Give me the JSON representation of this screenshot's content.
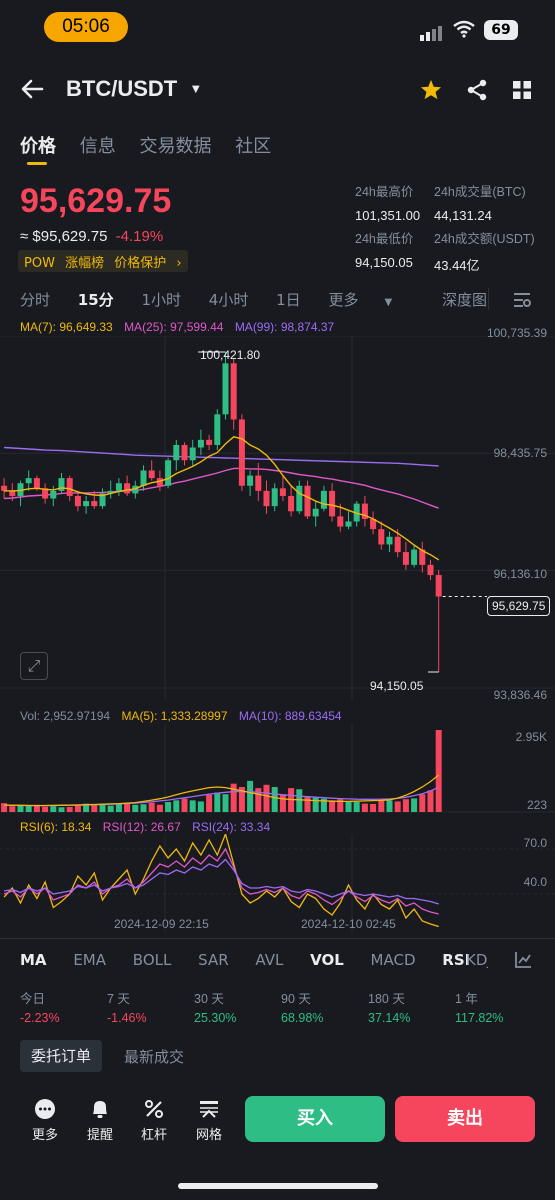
{
  "status": {
    "time": "05:06",
    "battery": "69"
  },
  "header": {
    "pair": "BTC/USDT"
  },
  "tabs": [
    "价格",
    "信息",
    "交易数据",
    "社区"
  ],
  "ticker": {
    "price": "95,629.75",
    "approx": "≈ $95,629.75",
    "change": "-4.19%",
    "tags": [
      "POW",
      "涨幅榜",
      "价格保护"
    ],
    "stats": [
      {
        "label": "24h最高价",
        "value": "101,351.00"
      },
      {
        "label": "24h成交量(BTC)",
        "value": "44,131.24"
      },
      {
        "label": "24h最低价",
        "value": "94,150.05"
      },
      {
        "label": "24h成交额(USDT)",
        "value": "43.44亿"
      }
    ]
  },
  "intervals": [
    "分时",
    "15分",
    "1小时",
    "4小时",
    "1日",
    "更多",
    "深度图"
  ],
  "indicators": {
    "ma7": "MA(7): 96,649.33",
    "ma25": "MA(25): 97,599.44",
    "ma99": "MA(99): 98,874.37",
    "vol": "Vol: 2,952.97194",
    "vol_ma5": "MA(5): 1,333.28997",
    "vol_ma10": "MA(10): 889.63454",
    "rsi6": "RSI(6): 18.34",
    "rsi12": "RSI(12): 26.67",
    "rsi24": "RSI(24): 33.34"
  },
  "chart_data": [
    {
      "type": "candlestick",
      "y_ticks": [
        "100,735.39",
        "98,435.75",
        "96,136.10",
        "93,836.46"
      ],
      "ylim": [
        93836.46,
        100735.39
      ],
      "annotations": {
        "high": "100,421.80",
        "low": "94,150.05",
        "last": "95,629.75"
      },
      "x_ticks": [
        "2024-12-09 22:15",
        "2024-12-10 02:45"
      ],
      "candles": [
        [
          97800,
          97950,
          97550,
          97700
        ],
        [
          97700,
          97850,
          97500,
          97600
        ],
        [
          97600,
          97900,
          97400,
          97850
        ],
        [
          97850,
          98100,
          97700,
          97950
        ],
        [
          97950,
          98000,
          97700,
          97750
        ],
        [
          97750,
          97850,
          97450,
          97550
        ],
        [
          97550,
          97800,
          97400,
          97700
        ],
        [
          97700,
          98050,
          97650,
          97950
        ],
        [
          97950,
          98000,
          97500,
          97600
        ],
        [
          97600,
          97700,
          97300,
          97400
        ],
        [
          97400,
          97600,
          97250,
          97500
        ],
        [
          97500,
          97700,
          97350,
          97400
        ],
        [
          97400,
          97750,
          97350,
          97650
        ],
        [
          97650,
          97900,
          97550,
          97700
        ],
        [
          97700,
          97950,
          97600,
          97850
        ],
        [
          97850,
          98000,
          97600,
          97650
        ],
        [
          97650,
          97900,
          97550,
          97800
        ],
        [
          97800,
          98200,
          97700,
          98100
        ],
        [
          98100,
          98300,
          97900,
          97950
        ],
        [
          97950,
          98100,
          97700,
          97800
        ],
        [
          97800,
          98350,
          97750,
          98300
        ],
        [
          98300,
          98700,
          98100,
          98600
        ],
        [
          98600,
          98650,
          98200,
          98300
        ],
        [
          98300,
          98700,
          98200,
          98550
        ],
        [
          98550,
          98900,
          98400,
          98700
        ],
        [
          98700,
          98800,
          98500,
          98600
        ],
        [
          98600,
          99300,
          98500,
          99200
        ],
        [
          99200,
          100421.8,
          99100,
          100200
        ],
        [
          100200,
          100300,
          98900,
          99100
        ],
        [
          99100,
          99200,
          97700,
          97800
        ],
        [
          97800,
          98100,
          97600,
          98000
        ],
        [
          98000,
          98250,
          97500,
          97700
        ],
        [
          97700,
          97900,
          97250,
          97400
        ],
        [
          97400,
          97850,
          97300,
          97750
        ],
        [
          97750,
          98000,
          97500,
          97600
        ],
        [
          97600,
          97800,
          97200,
          97300
        ],
        [
          97300,
          97900,
          97250,
          97800
        ],
        [
          97800,
          97900,
          97150,
          97200
        ],
        [
          97200,
          97500,
          97000,
          97350
        ],
        [
          97350,
          97800,
          97300,
          97700
        ],
        [
          97700,
          97850,
          97100,
          97200
        ],
        [
          97200,
          97450,
          96900,
          97000
        ],
        [
          97000,
          97300,
          96950,
          97100
        ],
        [
          97100,
          97500,
          97000,
          97450
        ],
        [
          97450,
          97600,
          97000,
          97150
        ],
        [
          97150,
          97300,
          96850,
          96950
        ],
        [
          96950,
          97100,
          96550,
          96650
        ],
        [
          96650,
          96900,
          96500,
          96800
        ],
        [
          96800,
          96950,
          96400,
          96500
        ],
        [
          96500,
          96700,
          96150,
          96250
        ],
        [
          96250,
          96650,
          96200,
          96550
        ],
        [
          96550,
          96700,
          96100,
          96250
        ],
        [
          96250,
          96350,
          95950,
          96050
        ],
        [
          96050,
          96150,
          94150.05,
          95629.75
        ]
      ],
      "ma7": [
        97700,
        97700,
        97710,
        97740,
        97750,
        97730,
        97720,
        97760,
        97740,
        97680,
        97640,
        97620,
        97610,
        97650,
        97690,
        97720,
        97740,
        97810,
        97860,
        97890,
        97940,
        98040,
        98110,
        98180,
        98270,
        98380,
        98450,
        98620,
        98760,
        98720,
        98600,
        98520,
        98400,
        98220,
        98000,
        97800,
        97650,
        97580,
        97500,
        97440,
        97420,
        97380,
        97320,
        97260,
        97220,
        97150,
        97060,
        96970,
        96870,
        96760,
        96640,
        96530,
        96450,
        96350
      ],
      "ma25": [
        97550,
        97560,
        97580,
        97600,
        97610,
        97620,
        97630,
        97650,
        97660,
        97660,
        97660,
        97665,
        97670,
        97680,
        97690,
        97700,
        97710,
        97730,
        97760,
        97790,
        97820,
        97860,
        97890,
        97930,
        97970,
        98010,
        98050,
        98100,
        98140,
        98140,
        98130,
        98130,
        98120,
        98100,
        98080,
        98050,
        98020,
        98000,
        97980,
        97950,
        97930,
        97900,
        97870,
        97840,
        97810,
        97760,
        97720,
        97680,
        97640,
        97590,
        97540,
        97480,
        97420,
        97360
      ],
      "ma99": [
        98550,
        98540,
        98530,
        98520,
        98510,
        98500,
        98495,
        98490,
        98480,
        98470,
        98460,
        98450,
        98440,
        98430,
        98420,
        98410,
        98400,
        98395,
        98390,
        98385,
        98380,
        98375,
        98370,
        98365,
        98360,
        98355,
        98350,
        98345,
        98340,
        98335,
        98330,
        98325,
        98320,
        98315,
        98310,
        98305,
        98300,
        98295,
        98290,
        98285,
        98280,
        98275,
        98270,
        98265,
        98260,
        98255,
        98250,
        98245,
        98240,
        98230,
        98220,
        98210,
        98200,
        98190
      ]
    },
    {
      "type": "bar",
      "title": "Volume",
      "y_ticks": [
        "2.95K",
        "223"
      ],
      "values": [
        320,
        210,
        230,
        220,
        260,
        190,
        210,
        170,
        180,
        240,
        300,
        260,
        270,
        230,
        280,
        310,
        260,
        280,
        330,
        260,
        360,
        420,
        480,
        420,
        380,
        620,
        700,
        640,
        1020,
        900,
        1120,
        860,
        980,
        900,
        640,
        860,
        820,
        560,
        520,
        480,
        420,
        460,
        380,
        360,
        300,
        290,
        410,
        420,
        380,
        460,
        490,
        640,
        780,
        2952.97
      ],
      "ma5": [
        250,
        245,
        240,
        235,
        230,
        235,
        238,
        245,
        250,
        255,
        262,
        270,
        280,
        290,
        300,
        320,
        340,
        380,
        430,
        480,
        540,
        620,
        700,
        760,
        820,
        880,
        900,
        880,
        820,
        760,
        700,
        640,
        580,
        520,
        470,
        450,
        440,
        430,
        410,
        400,
        390,
        380,
        380,
        390,
        400,
        410,
        420,
        440,
        500,
        600,
        740,
        900,
        1100,
        1333.29
      ],
      "ma10": [
        240,
        238,
        236,
        234,
        232,
        232,
        234,
        238,
        242,
        246,
        252,
        260,
        270,
        280,
        292,
        306,
        322,
        342,
        368,
        398,
        430,
        470,
        512,
        556,
        598,
        640,
        680,
        710,
        730,
        740,
        730,
        710,
        680,
        650,
        620,
        596,
        574,
        552,
        532,
        514,
        496,
        482,
        470,
        462,
        458,
        456,
        460,
        470,
        490,
        530,
        590,
        660,
        760,
        889.63
      ]
    },
    {
      "type": "line",
      "title": "RSI",
      "y_ticks": [
        "70.0",
        "40.0"
      ],
      "ylim": [
        20,
        80
      ],
      "series": [
        {
          "name": "RSI(6)",
          "values": [
            38,
            44,
            34,
            46,
            37,
            48,
            31,
            35,
            40,
            52,
            46,
            54,
            36,
            44,
            50,
            56,
            40,
            50,
            62,
            72,
            64,
            70,
            62,
            74,
            66,
            76,
            66,
            80,
            60,
            40,
            34,
            37,
            42,
            38,
            44,
            35,
            31,
            40,
            37,
            30,
            26,
            34,
            46,
            36,
            30,
            40,
            33,
            30,
            36,
            24,
            30,
            22,
            20,
            18.34
          ]
        },
        {
          "name": "RSI(12)",
          "values": [
            40,
            42,
            38,
            44,
            40,
            44,
            36,
            38,
            40,
            46,
            44,
            48,
            40,
            44,
            46,
            50,
            44,
            48,
            54,
            60,
            58,
            62,
            58,
            64,
            60,
            66,
            62,
            70,
            58,
            44,
            40,
            41,
            43,
            41,
            44,
            39,
            37,
            42,
            40,
            36,
            33,
            37,
            42,
            38,
            35,
            39,
            36,
            34,
            37,
            32,
            34,
            30,
            28,
            26.67
          ]
        },
        {
          "name": "RSI(24)",
          "values": [
            42,
            43,
            41,
            44,
            42,
            44,
            40,
            41,
            42,
            45,
            44,
            46,
            42,
            44,
            45,
            47,
            44,
            46,
            50,
            54,
            53,
            56,
            54,
            58,
            56,
            60,
            58,
            63,
            56,
            47,
            44,
            44,
            45,
            44,
            45,
            42,
            41,
            43,
            42,
            40,
            38,
            40,
            42,
            40,
            39,
            40,
            39,
            38,
            39,
            37,
            37,
            36,
            35,
            33.34
          ]
        }
      ]
    }
  ],
  "period_tabs": [
    "MA",
    "EMA",
    "BOLL",
    "SAR",
    "AVL",
    "VOL",
    "MACD",
    "RSI",
    "KDJ"
  ],
  "returns": [
    {
      "label": "今日",
      "value": "-2.23%"
    },
    {
      "label": "7 天",
      "value": "-1.46%"
    },
    {
      "label": "30 天",
      "value": "25.30%"
    },
    {
      "label": "90 天",
      "value": "68.98%"
    },
    {
      "label": "180 天",
      "value": "37.14%"
    },
    {
      "label": "1 年",
      "value": "117.82%"
    }
  ],
  "orders": {
    "open_orders": "委托订单",
    "latest_trades": "最新成交"
  },
  "bottom_nav": [
    "更多",
    "提醒",
    "杠杆",
    "网格"
  ],
  "actions": {
    "buy": "买入",
    "sell": "卖出"
  },
  "colors": {
    "up": "#2ebd85",
    "down": "#f6465d",
    "accent": "#f0b90b",
    "ma7": "#f0b90b",
    "ma25": "#e058c8",
    "ma99": "#9c6cf2"
  }
}
